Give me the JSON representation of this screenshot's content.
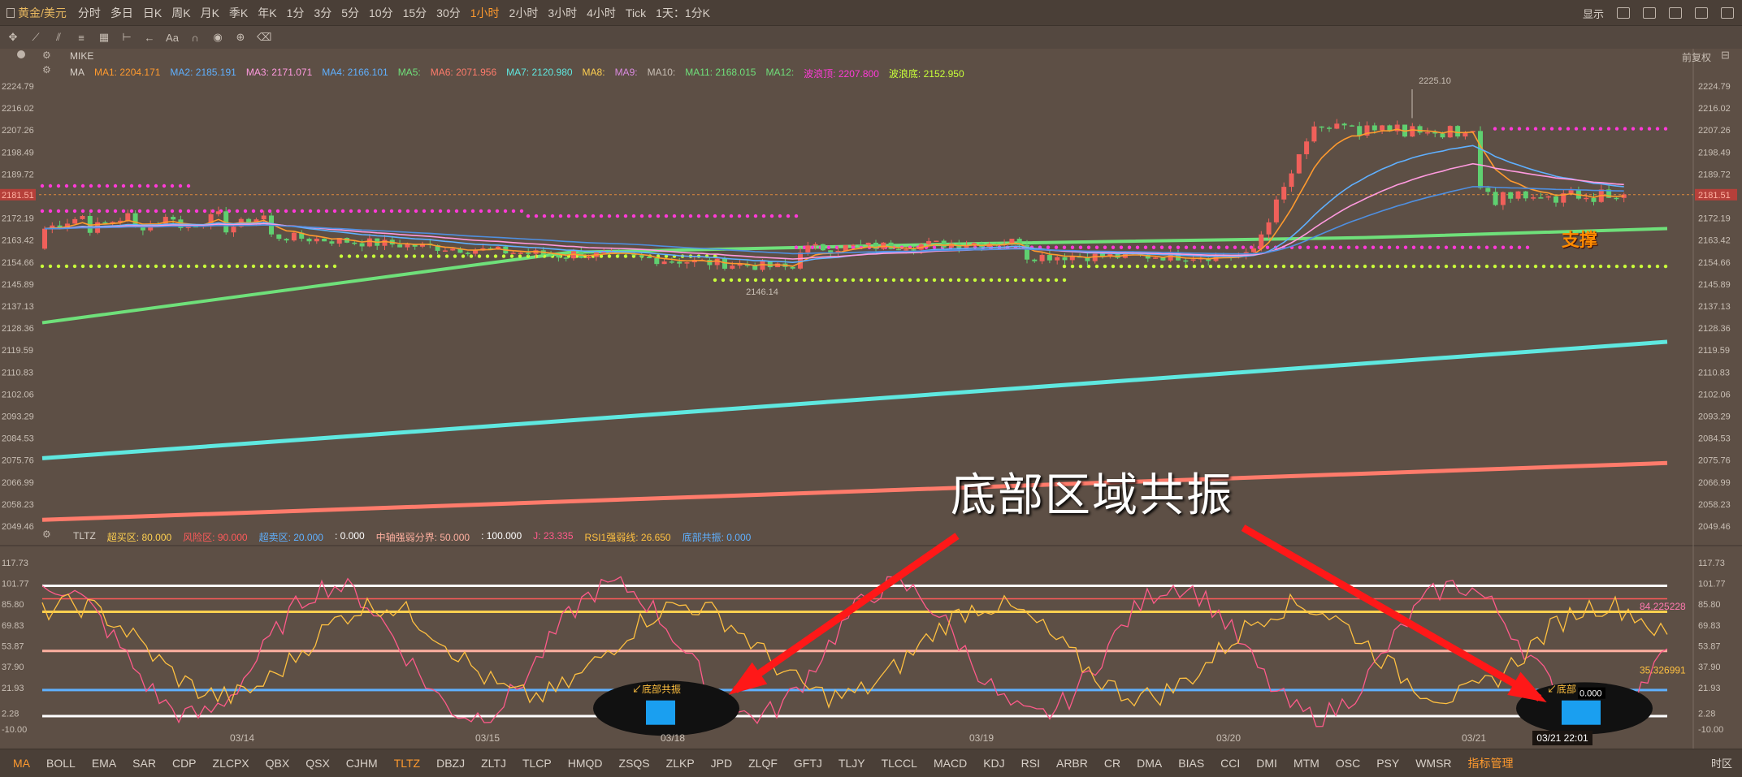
{
  "topbar": {
    "symbol": "黄金/美元",
    "periods": [
      "分时",
      "多日",
      "日K",
      "周K",
      "月K",
      "季K",
      "年K",
      "1分",
      "3分",
      "5分",
      "10分",
      "15分",
      "30分",
      "1小时",
      "2小时",
      "3小时",
      "4小时",
      "Tick"
    ],
    "active_period": "1小时",
    "custom_period": "1天：1分K",
    "display_label": "显示"
  },
  "main_panel": {
    "indicator_name": "MIKE",
    "ma_label": "MA",
    "restore_label": "前复权",
    "ma_items": [
      {
        "label": "MA1:",
        "value": "2204.171",
        "color": "#ff9a2e"
      },
      {
        "label": "MA2:",
        "value": "2185.191",
        "color": "#5fb0ff"
      },
      {
        "label": "MA3:",
        "value": "2171.071",
        "color": "#ff9adf"
      },
      {
        "label": "MA4:",
        "value": "2166.101",
        "color": "#5fb0ff"
      },
      {
        "label": "MA5:",
        "value": "",
        "color": "#6fe07a"
      },
      {
        "label": "MA6:",
        "value": "2071.956",
        "color": "#ff7b6b"
      },
      {
        "label": "MA7:",
        "value": "2120.980",
        "color": "#5fe8e0"
      },
      {
        "label": "MA8:",
        "value": "",
        "color": "#ffd050"
      },
      {
        "label": "MA9:",
        "value": "",
        "color": "#d98adf"
      },
      {
        "label": "MA10:",
        "value": "",
        "color": "#c9bfb5"
      },
      {
        "label": "MA11:",
        "value": "2168.015",
        "color": "#6fe07a"
      },
      {
        "label": "MA12:",
        "value": "",
        "color": "#6fe07a"
      },
      {
        "label": "波浪顶:",
        "value": "2207.800",
        "color": "#ff3ad8"
      },
      {
        "label": "波浪底:",
        "value": "2152.950",
        "color": "#c8ff3a"
      }
    ],
    "y_ticks": [
      "2224.79",
      "2216.02",
      "2207.26",
      "2198.49",
      "2189.72",
      "2181.51",
      "2172.19",
      "2163.42",
      "2154.66",
      "2145.89",
      "2137.13",
      "2128.36",
      "2119.59",
      "2110.83",
      "2102.06",
      "2093.29",
      "2084.53",
      "2075.76",
      "2066.99",
      "2058.23",
      "2049.46"
    ],
    "current_price": "2181.51",
    "high_label": "2225.10",
    "low_label": "2146.14",
    "support_label": "支撑",
    "annotation": "底部区域共振"
  },
  "sub_panel": {
    "indicator_name": "TLTZ",
    "items": [
      {
        "label": "超买区:",
        "value": "80.000",
        "color": "#ffd050"
      },
      {
        "label": "风险区:",
        "value": "90.000",
        "color": "#ff5a5a"
      },
      {
        "label": "超卖区:",
        "value": "20.000",
        "color": "#5fb0ff"
      },
      {
        "label": ":",
        "value": "0.000",
        "color": "#ffffff"
      },
      {
        "label": "中轴强弱分界:",
        "value": "50.000",
        "color": "#ffb0a0"
      },
      {
        "label": ":",
        "value": "100.000",
        "color": "#ffffff"
      },
      {
        "label": "J:",
        "value": "23.335",
        "color": "#ff5a8a"
      },
      {
        "label": "RSI1强弱线:",
        "value": "26.650",
        "color": "#ffc040"
      },
      {
        "label": "底部共振:",
        "value": "0.000",
        "color": "#5fb0ff"
      }
    ],
    "y_ticks": [
      "117.73",
      "101.77",
      "85.80",
      "69.83",
      "53.87",
      "37.90",
      "21.93",
      "2.28",
      "-10.00"
    ],
    "right_value_1": "84.225228",
    "right_value_2": "35.326991",
    "signal_label": "底部共振",
    "signal_label_2": "底部",
    "cursor_value": "0.000"
  },
  "x_axis": {
    "dates": [
      "03/14",
      "03/15",
      "03/18",
      "03/19",
      "03/20",
      "03/21"
    ],
    "cursor_time": "03/21 22:01"
  },
  "bottombar": {
    "indicators": [
      "MA",
      "BOLL",
      "EMA",
      "SAR",
      "CDP",
      "ZLCPX",
      "QBX",
      "QSX",
      "CJHM",
      "TLTZ",
      "DBZJ",
      "ZLTJ",
      "TLCP",
      "HMQD",
      "ZSQS",
      "ZLKP",
      "JPD",
      "ZLQF",
      "GFTJ",
      "TLJY",
      "TLCCL",
      "MACD",
      "KDJ",
      "RSI",
      "ARBR",
      "CR",
      "DMA",
      "BIAS",
      "CCI",
      "DMI",
      "MTM",
      "OSC",
      "PSY",
      "WMSR"
    ],
    "active": [
      "MA",
      "TLTZ"
    ],
    "manage_label": "指标管理",
    "timeframe": "时区"
  }
}
